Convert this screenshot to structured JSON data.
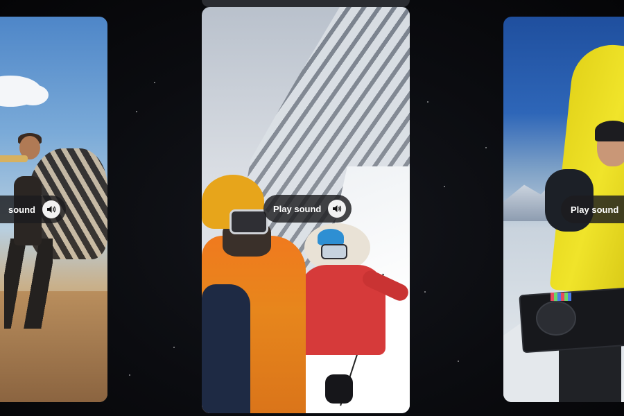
{
  "cards": [
    {
      "id": "left",
      "sound_button": {
        "label": "Play sound",
        "visible_label": "sound",
        "icon": "speaker-icon"
      }
    },
    {
      "id": "center",
      "sound_button": {
        "label": "Play sound",
        "visible_label": "Play sound",
        "icon": "speaker-icon"
      }
    },
    {
      "id": "right",
      "sound_button": {
        "label": "Play sound",
        "visible_label": "Play sound",
        "icon": "speaker-icon"
      }
    }
  ],
  "colors": {
    "background": "#0b0c10",
    "pill_background": "#1c1c1e",
    "pill_text": "#ffffff",
    "speaker_circle": "#f2f2f2"
  }
}
